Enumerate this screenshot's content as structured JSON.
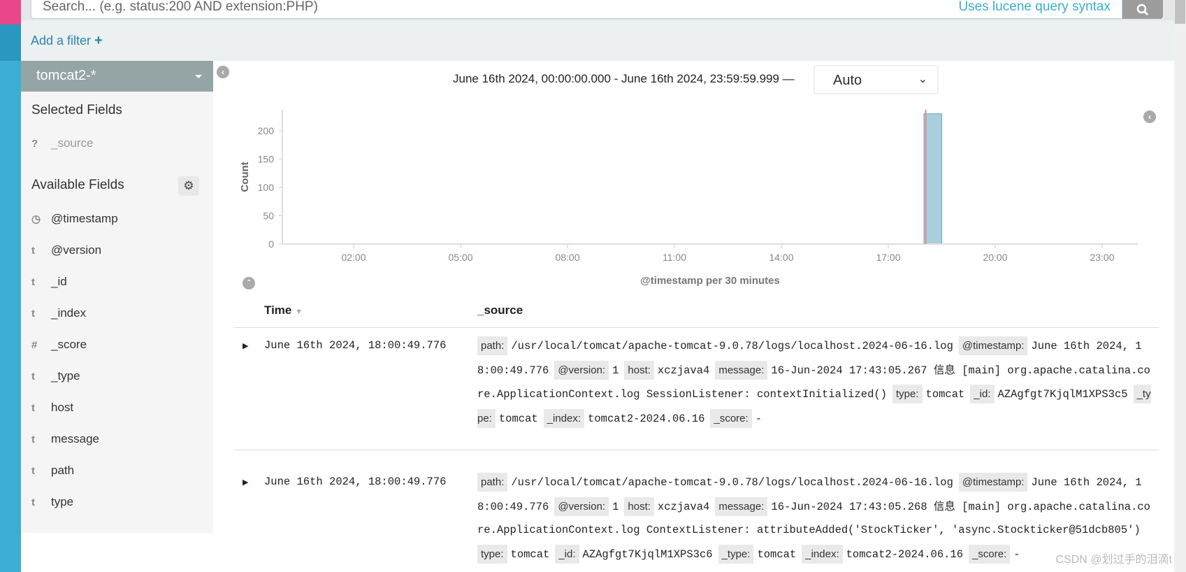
{
  "search": {
    "placeholder": "Search... (e.g. status:200 AND extension:PHP)",
    "hint": "Uses lucene query syntax",
    "icon": "search-icon"
  },
  "filter": {
    "label": "Add a filter",
    "icon": "plus-icon"
  },
  "sidebar": {
    "index_pattern": "tomcat2-*",
    "selected_title": "Selected Fields",
    "selected": [
      {
        "type": "?",
        "name": "_source"
      }
    ],
    "available_title": "Available Fields",
    "available": [
      {
        "type": "◷",
        "name": "@timestamp"
      },
      {
        "type": "t",
        "name": "@version"
      },
      {
        "type": "t",
        "name": "_id"
      },
      {
        "type": "t",
        "name": "_index"
      },
      {
        "type": "#",
        "name": "_score"
      },
      {
        "type": "t",
        "name": "_type"
      },
      {
        "type": "t",
        "name": "host"
      },
      {
        "type": "t",
        "name": "message"
      },
      {
        "type": "t",
        "name": "path"
      },
      {
        "type": "t",
        "name": "type"
      }
    ]
  },
  "time": {
    "range": "June 16th 2024, 00:00:00.000 - June 16th 2024, 23:59:59.999 —",
    "interval": "Auto"
  },
  "chart_data": {
    "type": "bar",
    "xlabel": "@timestamp per 30 minutes",
    "ylabel": "Count",
    "x_ticks": [
      "02:00",
      "05:00",
      "08:00",
      "11:00",
      "14:00",
      "17:00",
      "20:00",
      "23:00"
    ],
    "x_tick_hours": [
      2,
      5,
      8,
      11,
      14,
      17,
      20,
      23
    ],
    "xlim_hours": [
      0,
      24
    ],
    "y_ticks": [
      0,
      50,
      100,
      150,
      200
    ],
    "ylim": [
      0,
      237
    ],
    "bars": [
      {
        "start": "18:00",
        "start_hour": 18,
        "width_hours": 0.5,
        "value": 230
      }
    ],
    "marker_hour": 18.05,
    "colors": {
      "bar": "#a8cfdb",
      "marker": "#e88a8a"
    }
  },
  "table": {
    "headers": {
      "time": "Time",
      "source": "_source"
    },
    "rows": [
      {
        "time": "June 16th 2024, 18:00:49.776",
        "fields": [
          [
            "path:",
            "/usr/local/tomcat/apache-tomcat-9.0.78/logs/localhost.2024-06-16.log"
          ],
          [
            "@timestamp:",
            "June 16th 2024, 18:00:49.776"
          ],
          [
            "@version:",
            "1"
          ],
          [
            "host:",
            "xczjava4"
          ],
          [
            "message:",
            "16-Jun-2024 17:43:05.267 信息 [main] org.apache.catalina.core.ApplicationContext.log SessionListener: contextInitialized()"
          ],
          [
            "type:",
            "tomcat"
          ],
          [
            "_id:",
            "AZAgfgt7KjqlM1XPS3c5"
          ],
          [
            "_type:",
            "tomcat"
          ],
          [
            "_index:",
            "tomcat2-2024.06.16"
          ],
          [
            "_score:",
            "-"
          ]
        ]
      },
      {
        "time": "June 16th 2024, 18:00:49.776",
        "fields": [
          [
            "path:",
            "/usr/local/tomcat/apache-tomcat-9.0.78/logs/localhost.2024-06-16.log"
          ],
          [
            "@timestamp:",
            "June 16th 2024, 18:00:49.776"
          ],
          [
            "@version:",
            "1"
          ],
          [
            "host:",
            "xczjava4"
          ],
          [
            "message:",
            "16-Jun-2024 17:43:05.268 信息 [main] org.apache.catalina.core.ApplicationContext.log ContextListener: attributeAdded('StockTicker', 'async.Stockticker@51dcb805')"
          ],
          [
            "type:",
            "tomcat"
          ],
          [
            "_id:",
            "AZAgfgt7KjqlM1XPS3c6"
          ],
          [
            "_type:",
            "tomcat"
          ],
          [
            "_index:",
            "tomcat2-2024.06.16"
          ],
          [
            "_score:",
            "-"
          ]
        ]
      }
    ]
  },
  "watermark": "CSDN @划过手的泪滴t"
}
